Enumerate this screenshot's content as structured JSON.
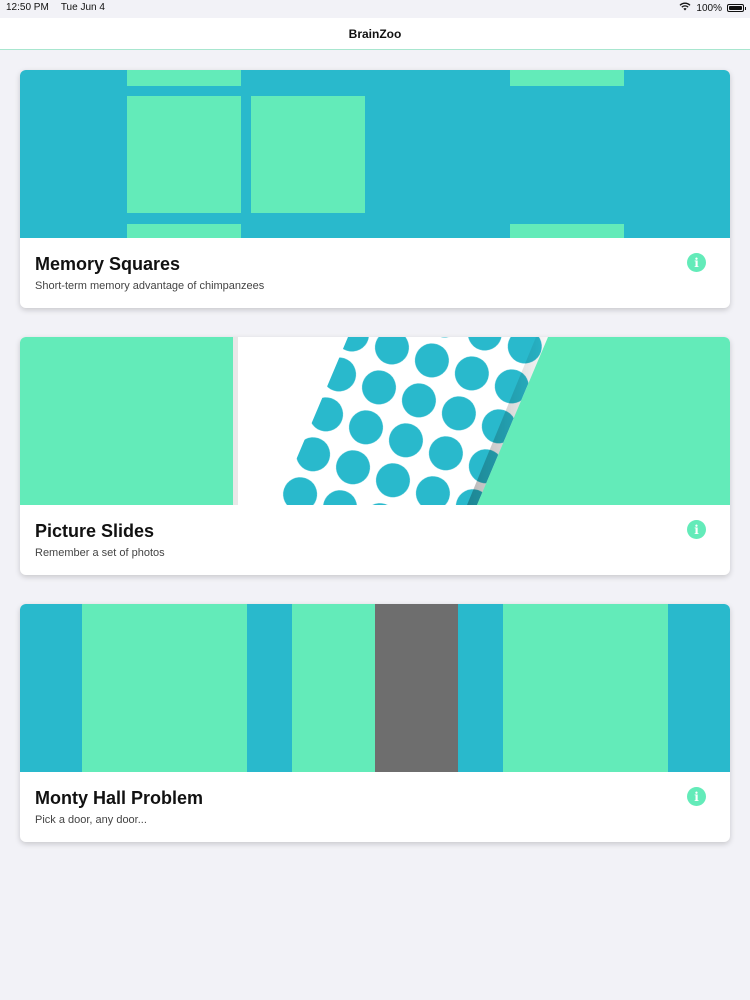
{
  "status_bar": {
    "time": "12:50 PM",
    "date": "Tue Jun 4",
    "battery": "100%",
    "battery_level": 1.0,
    "icons": [
      "wifi-icon",
      "battery-icon"
    ]
  },
  "nav": {
    "title": "BrainZoo"
  },
  "colors": {
    "teal": "#29b9cc",
    "mint": "#63ebb9",
    "gray_door": "#6e6e6e",
    "background": "#f2f2f7"
  },
  "games": [
    {
      "title": "Memory Squares",
      "subtitle": "Short-term memory advantage of chimpanzees",
      "info_icon": "info-icon"
    },
    {
      "title": "Picture Slides",
      "subtitle": "Remember a set of photos",
      "info_icon": "info-icon"
    },
    {
      "title": "Monty Hall Problem",
      "subtitle": "Pick a door, any door...",
      "info_icon": "info-icon"
    }
  ]
}
